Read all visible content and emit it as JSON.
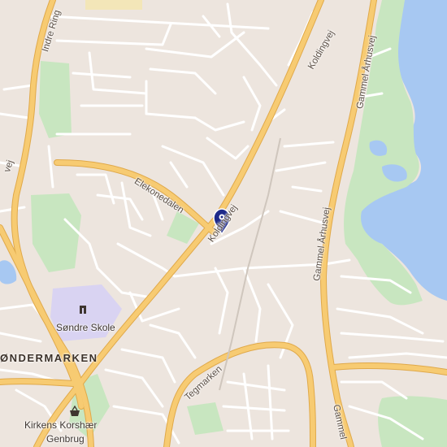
{
  "map": {
    "colors": {
      "land": "#ede5de",
      "water": "#a7c8f2",
      "park": "#c8e6c0",
      "school": "#d9d3f2",
      "major_road": "#f5c36a",
      "minor_road": "#ffffff",
      "marker": "#1e2a8a"
    },
    "road_labels": {
      "indre_ring": "Indre Ring",
      "koldingvej_north": "Koldingvej",
      "koldingvej_marker": "Koldingvej",
      "gammel_arhusvej_top": "Gammel Århusvej",
      "gammel_arhusvej_mid": "Gammel Århusvej",
      "gammel_arhusvej_bottom": "Gammel",
      "elkonedalen": "Elekonedalen",
      "tegmarken": "Tegmarken",
      "left_edge": "vej"
    },
    "pois": {
      "school": "Søndre Skole",
      "shop_line1": "Kirkens Korshær",
      "shop_line2": "Genbrug"
    },
    "district": "ØNDERMARKEN",
    "icons": {
      "marker": "map-pin-icon",
      "school": "school-icon",
      "shop": "shopping-basket-icon"
    }
  }
}
